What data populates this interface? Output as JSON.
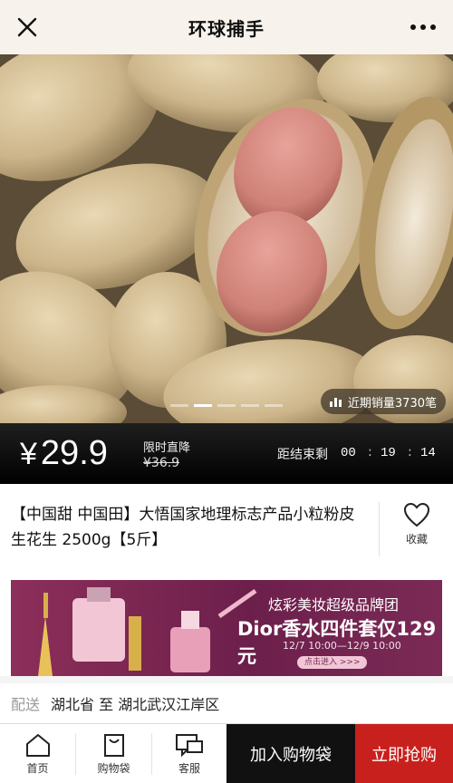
{
  "header": {
    "title": "环球捕手",
    "close_icon": "close-icon",
    "more_icon": "more-icon"
  },
  "hero": {
    "sales_label": "近期销量3730笔",
    "slide_count": 5,
    "active_slide": 2
  },
  "pricing": {
    "currency": "¥",
    "price": "29.9",
    "promo_label": "限时直降",
    "old_price": "¥36.9",
    "countdown_label": "距结束剩",
    "countdown": {
      "hours": "00",
      "minutes": "19",
      "seconds": "14"
    }
  },
  "product": {
    "title": "【中国甜 中国田】大悟国家地理标志产品小粒粉皮生花生 2500g【5斤】",
    "favorite_label": "收藏"
  },
  "banner": {
    "line1": "炫彩美妆超级品牌团",
    "line2": "Dior香水四件套仅129元",
    "line3": "12/7  10:00—12/9  10:00",
    "button": "点击进入 >>>"
  },
  "delivery": {
    "label": "配送",
    "text": "湖北省 至 湖北武汉江岸区"
  },
  "bottom_bar": {
    "home_label": "首页",
    "bag_label": "购物袋",
    "service_label": "客服",
    "add_to_cart": "加入购物袋",
    "buy_now": "立即抢购"
  },
  "colors": {
    "accent_red": "#c8211d",
    "header_bg": "#f7f3ec",
    "price_bar": "#000000",
    "banner_bg": "#7a2a55"
  }
}
